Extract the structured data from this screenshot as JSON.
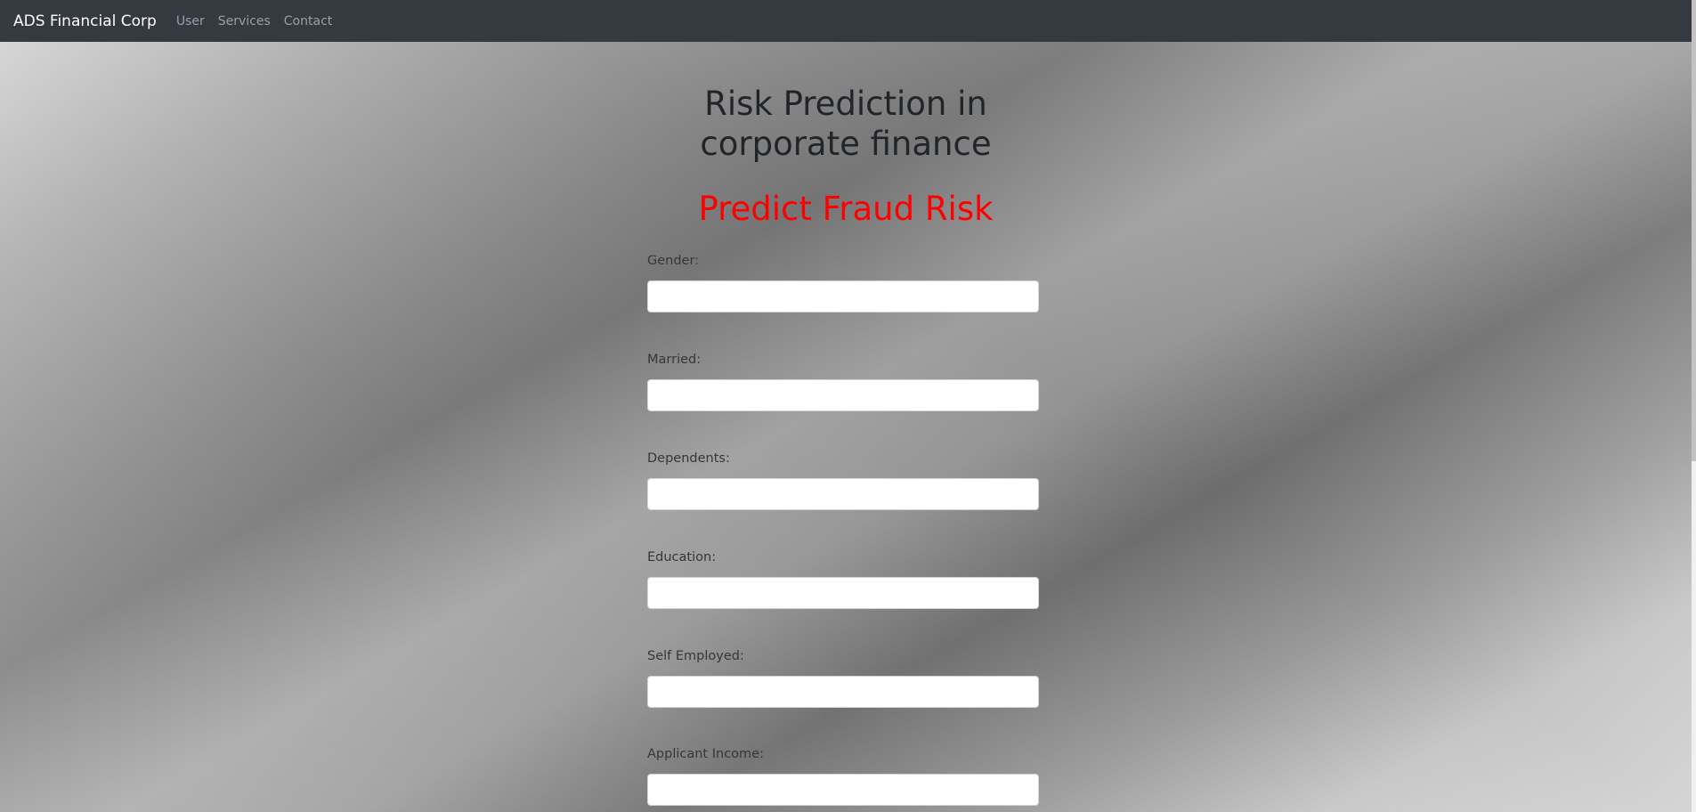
{
  "navbar": {
    "brand": "ADS Financial Corp",
    "links": [
      "User",
      "Services",
      "Contact"
    ]
  },
  "page": {
    "title_line1": "Risk Prediction in",
    "title_line2": "corporate finance",
    "subtitle": "Predict Fraud Risk"
  },
  "form": {
    "fields": [
      {
        "label": "Gender:",
        "value": ""
      },
      {
        "label": "Married:",
        "value": ""
      },
      {
        "label": "Dependents:",
        "value": ""
      },
      {
        "label": "Education:",
        "value": ""
      },
      {
        "label": "Self Employed:",
        "value": ""
      },
      {
        "label": "Applicant Income:",
        "value": ""
      }
    ]
  },
  "colors": {
    "navbar_bg": "#343a40",
    "subtitle": "#ff0000",
    "title": "#212529"
  }
}
